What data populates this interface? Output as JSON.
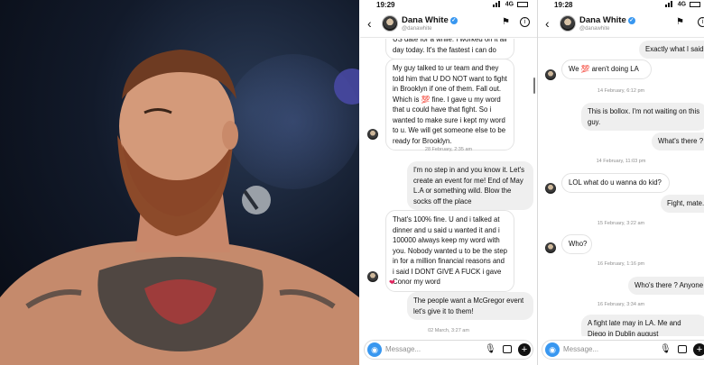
{
  "left_screen": {
    "status_time": "19:29",
    "network": "4G",
    "header": {
      "name": "Dana White",
      "handle": "@danawhite"
    },
    "messages": [
      {
        "dir": "in",
        "text": "US date for a while. I worked on it all day today. It's the fastest i can do"
      },
      {
        "dir": "in",
        "text": "My guy talked to ur team and they told him that U DO NOT want to fight in Brooklyn if one of them. Fall out. Which is 💯 fine. I gave u my word that u could have that fight. So i wanted to make sure i kept my word to u. We will get someone else to be ready for Brooklyn."
      },
      {
        "dir": "ts",
        "text": "28 February, 2:35 am"
      },
      {
        "dir": "out",
        "text": "I'm no step in and you know it. Let's create an event for me! End of May L.A or something wild. Blow the socks off the place"
      },
      {
        "dir": "in",
        "text": "That's 100% fine. U and i talked at dinner and u said u wanted it and i 100000 always keep my word with you. Nobody wanted u to be the step in for a million financial reasons and i said I DONT GIVE A FUCK i gave Conor my word"
      },
      {
        "dir": "heart",
        "text": "❤"
      },
      {
        "dir": "out",
        "text": "The people want a McGregor event let's give it to them!"
      },
      {
        "dir": "ts",
        "text": "02 March, 3:27 am"
      }
    ],
    "composer_placeholder": "Message..."
  },
  "right_screen": {
    "status_time": "19:28",
    "network": "4G",
    "header": {
      "name": "Dana White",
      "handle": "@danawhite"
    },
    "messages": [
      {
        "dir": "out",
        "text": "Exactly what I said"
      },
      {
        "dir": "in",
        "text": "We 💯 aren't doing LA"
      },
      {
        "dir": "ts",
        "text": "14 February, 6:12 pm"
      },
      {
        "dir": "out",
        "text": "This is bollox. I'm not waiting on this guy."
      },
      {
        "dir": "out",
        "text": "What's there ?"
      },
      {
        "dir": "ts",
        "text": "14 February, 11:03 pm"
      },
      {
        "dir": "in",
        "text": "LOL what do u wanna do kid?"
      },
      {
        "dir": "out",
        "text": "Fight, mate."
      },
      {
        "dir": "ts",
        "text": "15 February, 3:22 am"
      },
      {
        "dir": "in",
        "text": "Who?"
      },
      {
        "dir": "ts",
        "text": "16 February, 1:16 pm"
      },
      {
        "dir": "out",
        "text": "Who's there ? Anyone"
      },
      {
        "dir": "ts",
        "text": "16 February, 3:34 am"
      },
      {
        "dir": "out",
        "text": "A fight late may in LA. Me and Diego in Dublin august"
      }
    ],
    "composer_placeholder": "Message..."
  },
  "colors": {
    "accent": "#3897f0",
    "incoming_bubble": "#ffffff",
    "outgoing_bubble": "#efefef"
  },
  "icons": [
    "back-chevron-icon",
    "verified-badge-icon",
    "flag-icon",
    "info-icon",
    "camera-icon",
    "microphone-icon",
    "gallery-icon",
    "plus-icon"
  ]
}
